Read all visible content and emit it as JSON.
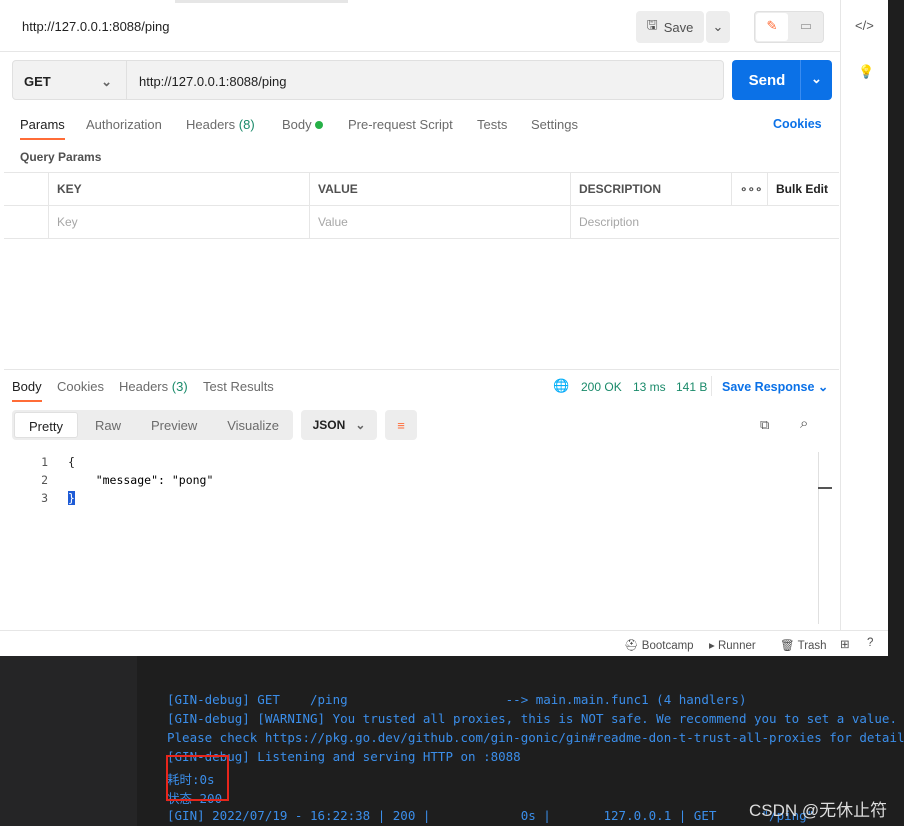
{
  "request": {
    "tab_title": "http://127.0.0.1:8088/ping",
    "save_label": "Save",
    "method": "GET",
    "url": "http://127.0.0.1:8088/ping",
    "send_label": "Send"
  },
  "req_tabs": [
    {
      "label": "Params",
      "active": true
    },
    {
      "label": "Authorization"
    },
    {
      "label": "Headers",
      "count": "(8)"
    },
    {
      "label": "Body"
    },
    {
      "label": "Pre-request Script"
    },
    {
      "label": "Tests"
    },
    {
      "label": "Settings"
    }
  ],
  "cookies_link": "Cookies",
  "query_params_title": "Query Params",
  "params_table": {
    "headers": [
      "KEY",
      "VALUE",
      "DESCRIPTION"
    ],
    "bulk_edit": "Bulk Edit",
    "placeholders": [
      "Key",
      "Value",
      "Description"
    ]
  },
  "response": {
    "tabs": [
      {
        "label": "Body",
        "active": true
      },
      {
        "label": "Cookies"
      },
      {
        "label": "Headers",
        "count": "(3)"
      },
      {
        "label": "Test Results"
      }
    ],
    "status": "200 OK",
    "time": "13 ms",
    "size": "141 B",
    "save_response": "Save Response",
    "views": [
      "Pretty",
      "Raw",
      "Preview",
      "Visualize"
    ],
    "format": "JSON",
    "lines": [
      {
        "n": "1",
        "t": "{"
      },
      {
        "n": "2",
        "t": "    \"message\": \"pong\""
      },
      {
        "n": "3",
        "t": "}"
      }
    ]
  },
  "footer": {
    "bootcamp": "Bootcamp",
    "runner": "Runner",
    "trash": "Trash"
  },
  "terminal": {
    "lines": [
      "[GIN-debug] GET    /ping                     --> main.main.func1 (4 handlers)",
      "[GIN-debug] [WARNING] You trusted all proxies, this is NOT safe. We recommend you to set a value.",
      "Please check https://pkg.go.dev/github.com/gin-gonic/gin#readme-don-t-trust-all-proxies for details.",
      "[GIN-debug] Listening and serving HTTP on :8088",
      "耗时:0s",
      "状态 200",
      "[GIN] 2022/07/19 - 16:22:38 | 200 |            0s |       127.0.0.1 | GET      \"/ping\""
    ]
  },
  "watermark": "CSDN @无休止符",
  "colors": {
    "accent": "#0b71e7",
    "tab_active": "#ff6c37",
    "status_ok": "#1a8a6a",
    "terminal_text": "#3b8eea",
    "highlight_box": "#e8261c"
  }
}
